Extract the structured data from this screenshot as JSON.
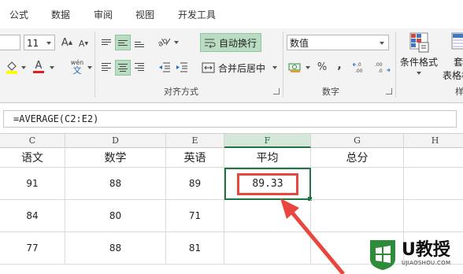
{
  "ribbon_tabs": [
    "公式",
    "数据",
    "审阅",
    "视图",
    "开发工具"
  ],
  "font": {
    "size": "11",
    "grow_label": "A",
    "shrink_label": "A",
    "wen_label": "wén",
    "wen_char": "文",
    "font_color_label": "A"
  },
  "alignment": {
    "wrap_text_label": "自动换行",
    "merge_center_label": "合并后居中",
    "group_label": "对齐方式"
  },
  "number": {
    "format_value": "数值",
    "percent_label": "%",
    "comma_label": ",",
    "increase_decimal_label": "←.0\n.00",
    "decrease_decimal_label": ".00\n→.0",
    "group_label": "数字"
  },
  "styles": {
    "conditional_format_label": "条件格式",
    "table_format_label_1": "套",
    "table_format_label_2": "表格格",
    "partial_group_label": "样"
  },
  "formula_bar": {
    "formula": "=AVERAGE(C2:E2)"
  },
  "sheet": {
    "columns": [
      {
        "letter": "C",
        "selected": false
      },
      {
        "letter": "D",
        "selected": false
      },
      {
        "letter": "E",
        "selected": false
      },
      {
        "letter": "F",
        "selected": true
      },
      {
        "letter": "G",
        "selected": false
      },
      {
        "letter": "H",
        "selected": false
      }
    ],
    "header_row": [
      "语文",
      "数学",
      "英语",
      "平均",
      "总分",
      ""
    ],
    "rows": [
      [
        "91",
        "88",
        "89",
        "89.33",
        "",
        ""
      ],
      [
        "84",
        "80",
        "71",
        "",
        "",
        ""
      ],
      [
        "77",
        "88",
        "81",
        "",
        "",
        ""
      ]
    ]
  },
  "watermark": {
    "logo_text": "U教授",
    "url_text": "UJIAOSHOU.COM"
  },
  "colors": {
    "accent_green": "#217346",
    "highlight_red": "#e8473f",
    "watermark_green": "#2e8b3a"
  }
}
